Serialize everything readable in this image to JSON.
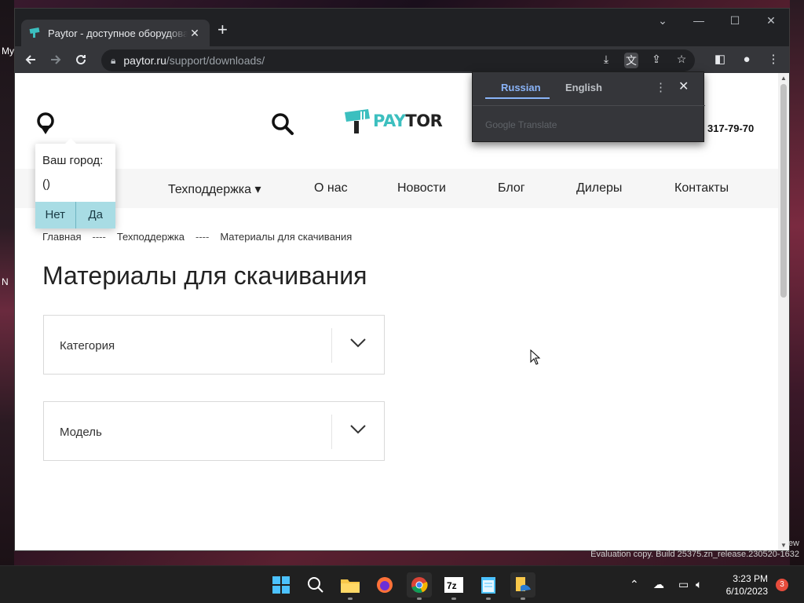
{
  "desktop": {
    "left_labels": [
      "My",
      "N"
    ],
    "right_label": "ew"
  },
  "browser": {
    "tab": {
      "title": "Paytor - доступное оборудование"
    },
    "window_controls": {
      "minimize": "—",
      "maximize": "☐",
      "close": "✕",
      "tab_search": "⌄"
    },
    "url": {
      "host": "paytor.ru",
      "path": "/support/downloads/"
    }
  },
  "site": {
    "logo": {
      "part1": "PAY",
      "part2": "TOR"
    },
    "phone": "317-79-70",
    "city_popup": {
      "label": "Ваш город:",
      "value": "()",
      "no": "Нет",
      "yes": "Да"
    },
    "nav": [
      "Техподдержка",
      "О нас",
      "Новости",
      "Блог",
      "Дилеры",
      "Контакты"
    ],
    "breadcrumb": {
      "home": "Главная",
      "sep": "----",
      "support": "Техподдержка",
      "current": "Материалы для скачивания"
    },
    "title": "Материалы для скачивания",
    "filters": {
      "category": "Категория",
      "model": "Модель"
    }
  },
  "translate": {
    "source": "Russian",
    "target": "English",
    "brand": "Google Translate"
  },
  "watermark": "Evaluation copy. Build 25375.zn_release.230520-1632",
  "taskbar": {
    "time": "3:23 PM",
    "date": "6/10/2023",
    "notifications": "3"
  }
}
